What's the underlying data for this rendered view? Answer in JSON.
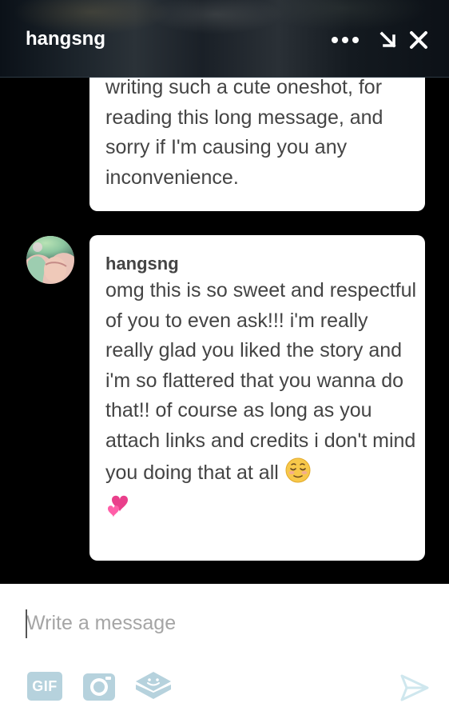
{
  "header": {
    "title": "hangsng",
    "icons": [
      "more-icon",
      "minimize-icon",
      "close-icon"
    ]
  },
  "messages": [
    {
      "text": "writing such a cute oneshot, for reading this long message, and sorry if I'm causing you any inconvenience."
    },
    {
      "sender": "hangsng",
      "text": "omg this is so sweet and respectful of you to even ask!!! i'm really really glad you liked the story and i'm so flattered that you wanna do that!! of course as long as you attach links and credits i don't mind you doing that at all",
      "emojis": [
        "relieved-face-emoji",
        "two-hearts-emoji"
      ]
    }
  ],
  "composer": {
    "placeholder": "Write a message",
    "gif_label": "GIF",
    "tools": [
      "gif-icon",
      "camera-icon",
      "sticker-icon",
      "send-icon"
    ]
  },
  "colors": {
    "bubble_text": "#444444",
    "tool_icon": "#b6d2dd",
    "send_icon": "#cfe7ee",
    "thread_bg": "#000000"
  }
}
